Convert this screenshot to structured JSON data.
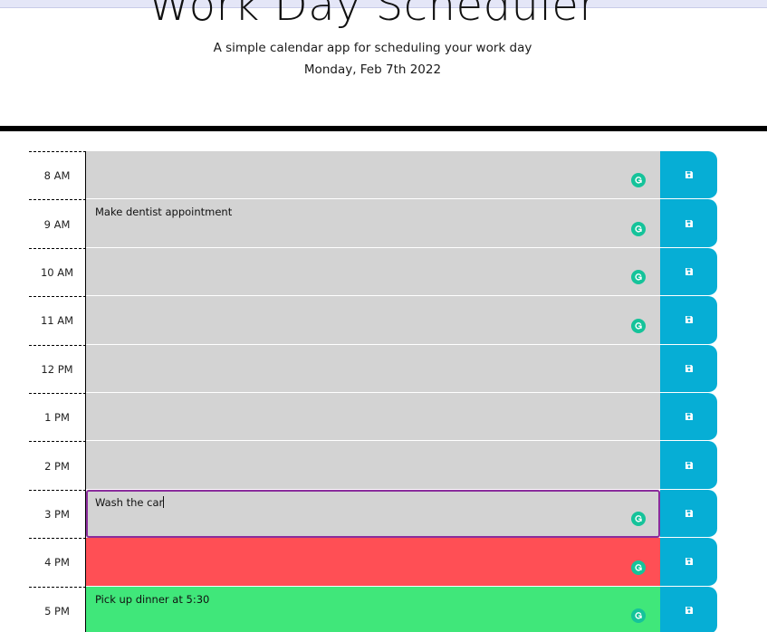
{
  "header": {
    "title": "Work Day Scheduler",
    "lead": "A simple calendar app for scheduling your work day",
    "current_day": "Monday, Feb 7th 2022"
  },
  "colors": {
    "past": "#d3d3d3",
    "present": "#ff4f55",
    "future": "#40e77a",
    "save": "#06aed5"
  },
  "rows": [
    {
      "hour": "8 AM",
      "text": "",
      "state": "past",
      "grammarly": true
    },
    {
      "hour": "9 AM",
      "text": "Make dentist appointment",
      "state": "past",
      "grammarly": true
    },
    {
      "hour": "10 AM",
      "text": "",
      "state": "past",
      "grammarly": true
    },
    {
      "hour": "11 AM",
      "text": "",
      "state": "past",
      "grammarly": true
    },
    {
      "hour": "12 PM",
      "text": "",
      "state": "past",
      "grammarly": false
    },
    {
      "hour": "1 PM",
      "text": "",
      "state": "past",
      "grammarly": false
    },
    {
      "hour": "2 PM",
      "text": "",
      "state": "past",
      "grammarly": false
    },
    {
      "hour": "3 PM",
      "text": "Wash the car",
      "state": "past",
      "grammarly": true,
      "focused": true
    },
    {
      "hour": "4 PM",
      "text": "",
      "state": "present",
      "grammarly": true
    },
    {
      "hour": "5 PM",
      "text": "Pick up dinner at 5:30",
      "state": "future",
      "grammarly": true
    }
  ],
  "icons": {
    "save": "floppy-disk-icon",
    "grammarly": "grammarly-icon"
  }
}
